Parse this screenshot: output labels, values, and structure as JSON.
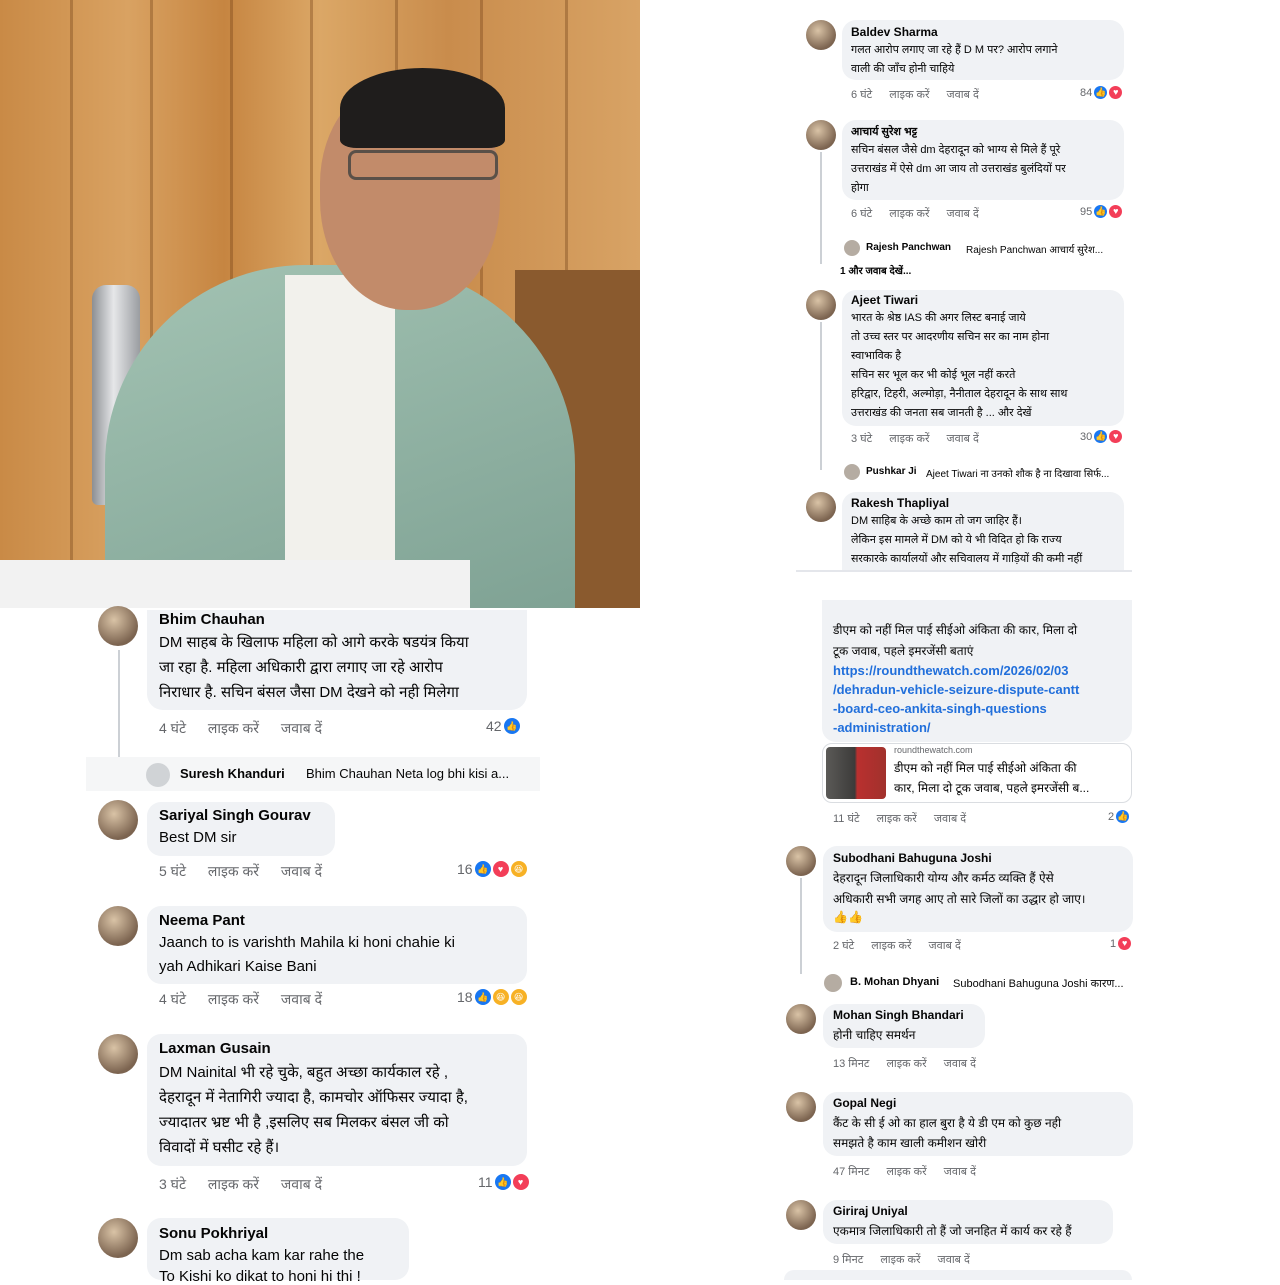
{
  "right_top": [
    {
      "name": "Baldev Sharma",
      "lines": [
        "गलत आरोप लगाए जा रहे हैं D M पर?   आरोप लगाने",
        "वाली की जाँच होनी चाहिये"
      ],
      "time": "6 घंटे",
      "like": "लाइक करें",
      "reply": "जवाब दें",
      "count": "84"
    },
    {
      "name": "आचार्य सुरेश भट्ट",
      "lines": [
        "सचिन बंसल जैसे dm देहरादून को भाग्य से मिले हैं पूरे",
        "उत्तराखंड में ऐसे dm आ जाय तो उत्तराखंड बुलंदियों पर",
        "होगा"
      ],
      "time": "6 घंटे",
      "like": "लाइक करें",
      "reply": "जवाब दें",
      "count": "95"
    },
    {
      "reply_name": "Rajesh Panchwan",
      "reply_text": "Rajesh Panchwan आचार्य सुरेश...",
      "more": "1 और जवाब देखें..."
    },
    {
      "name": "Ajeet Tiwari",
      "lines": [
        "भारत के श्रेष्ठ IAS की अगर लिस्ट बनाई जाये",
        "तो उच्च स्तर पर आदरणीय सचिन सर का नाम होना",
        "स्वाभाविक है",
        "सचिन सर  भूल कर भी कोई भूल नहीं करते",
        "हरिद्वार, टिहरी, अल्मोड़ा, नैनीताल देहरादून के साथ साथ",
        "उत्तराखंड की जनता सब जानती है ... और देखें"
      ],
      "time": "3 घंटे",
      "like": "लाइक करें",
      "reply": "जवाब दें",
      "count": "30"
    },
    {
      "reply_name": "Pushkar Ji",
      "reply_text": "Ajeet Tiwari ना उनको शौक है ना दिखावा सिर्फ..."
    },
    {
      "name": "Rakesh Thapliyal",
      "lines": [
        "DM साहिब के अच्छे काम तो जग जाहिर हैं।",
        "लेकिन इस मामले में DM को ये भी विदित हो कि राज्य",
        "सरकारके कार्यालयों और सचिवालय में गाड़ियों की कमी नहीं"
      ]
    }
  ],
  "left_bottom": [
    {
      "name": "Bhim Chauhan",
      "lines": [
        "DM साहब के खिलाफ महिला को आगे करके षडयंत्र किया",
        "जा रहा है. महिला अधिकारी द्वारा लगाए जा रहे आरोप",
        "निराधार है. सचिन बंसल जैसा  DM देखने को नही मिलेगा"
      ],
      "time": "4 घंटे",
      "like": "लाइक करें",
      "reply": "जवाब दें",
      "count": "42"
    },
    {
      "reply_name": "Suresh Khanduri",
      "reply_text": "Bhim Chauhan Neta log bhi kisi a..."
    },
    {
      "name": "Sariyal Singh Gourav",
      "lines": [
        "Best DM sir"
      ],
      "time": "5 घंटे",
      "like": "लाइक करें",
      "reply": "जवाब दें",
      "count": "16"
    },
    {
      "name": "Neema Pant",
      "lines": [
        "Jaanch to is varishth Mahila ki honi chahie ki",
        "yah Adhikari Kaise Bani"
      ],
      "time": "4 घंटे",
      "like": "लाइक करें",
      "reply": "जवाब दें",
      "count": "18"
    },
    {
      "name": "Laxman Gusain",
      "lines": [
        "DM Nainital भी रहे चुके, बहुत अच्छा कार्यकाल रहे ,",
        "देहरादून में नेतागिरी ज्यादा है, कामचोर ऑफिसर ज्यादा है,",
        "ज्यादातर भ्रष्ट भी है ,इसलिए सब मिलकर बंसल जी को",
        "विवादों में घसीट रहे हैं।"
      ],
      "time": "3 घंटे",
      "like": "लाइक करें",
      "reply": "जवाब दें",
      "count": "11"
    },
    {
      "name": "Sonu Pokhriyal",
      "lines": [
        "Dm sab acha kam kar rahe the",
        "To Kishi ko dikat to honi hi thi !"
      ]
    }
  ],
  "right_bottom": {
    "post": {
      "lines": [
        "डीएम को नहीं मिल पाई सीईओ अंकिता की कार, मिला दो",
        "टूक जवाब, पहले इमरजेंसी बताएं"
      ],
      "url_lines": [
        "https://roundthewatch.com/2026/02/03",
        "/dehradun-vehicle-seizure-dispute-cantt",
        "-board-ceo-ankita-singh-questions",
        "-administration/"
      ],
      "preview_domain": "roundthewatch.com",
      "preview_title": [
        "डीएम को नहीं मिल पाई सीईओ अंकिता की",
        "कार, मिला दो टूक जवाब, पहले इमरजेंसी ब..."
      ],
      "time": "11 घंटे",
      "like": "लाइक करें",
      "reply": "जवाब दें",
      "count": "2"
    },
    "comments": [
      {
        "name": "Subodhani Bahuguna Joshi",
        "lines": [
          "देहरादून जिलाधिकारी योग्य और कर्मठ व्यक्ति हैं  ऐसे",
          "अधिकारी सभी जगह आए तो सारे जिलों का उद्धार हो जाए।",
          "👍👍"
        ],
        "time": "2 घंटे",
        "like": "लाइक करें",
        "reply": "जवाब दें",
        "count": "1"
      },
      {
        "reply_name": "B. Mohan Dhyani",
        "reply_text": "Subodhani Bahuguna Joshi कारण..."
      },
      {
        "name": "Mohan Singh Bhandari",
        "lines": [
          "होनी चाहिए समर्थन"
        ],
        "time": "13 मिनट",
        "like": "लाइक करें",
        "reply": "जवाब दें"
      },
      {
        "name": "Gopal Negi",
        "lines": [
          "कैंट के सी ई ओ का हाल बुरा है ये डी एम को कुछ नही",
          "समझते है काम खाली कमीशन खोरी"
        ],
        "time": "47 मिनट",
        "like": "लाइक करें",
        "reply": "जवाब दें"
      },
      {
        "name": "Giriraj Uniyal",
        "lines": [
          "एकमात्र जिलाधिकारी तो हैं जो जनहित में कार्य कर रहे हैं"
        ],
        "time": "9 मिनट",
        "like": "लाइक करें",
        "reply": "जवाब दें"
      }
    ]
  },
  "colors": {
    "bubble": "#f0f2f5",
    "like": "#1877f2",
    "love": "#f33e58",
    "haha": "#f7b125",
    "link": "#216fdb",
    "meta": "#65676b"
  }
}
